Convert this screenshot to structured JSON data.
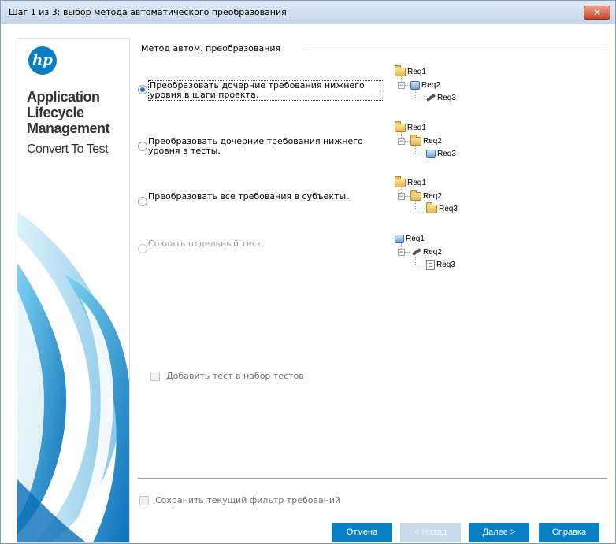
{
  "window": {
    "title": "Шаг 1 из 3: выбор метода автоматического преобразования",
    "close_label": "✕"
  },
  "branding": {
    "logo_text": "hp",
    "product_line1": "Application",
    "product_line2": "Lifecycle",
    "product_line3": "Management",
    "subtitle": "Convert To Test"
  },
  "method_group": {
    "title": "Метод автом. преобразования",
    "options": [
      {
        "label": "Преобразовать дочерние требования нижнего уровня в шаги проекта.",
        "checked": true,
        "enabled": true,
        "tree": [
          "Req1",
          "Req2",
          "Req3"
        ]
      },
      {
        "label": "Преобразовать дочерние требования нижнего уровня в тесты.",
        "checked": false,
        "enabled": true,
        "tree": [
          "Req1",
          "Req2",
          "Req3"
        ]
      },
      {
        "label": "Преобразовать все требования в субъекты.",
        "checked": false,
        "enabled": true,
        "tree": [
          "Req1",
          "Req2",
          "Req3"
        ]
      },
      {
        "label": "Создать отдельный тест.",
        "checked": false,
        "enabled": false,
        "tree": [
          "Req1",
          "Req2",
          "Req3"
        ]
      }
    ]
  },
  "add_to_test_set": {
    "label": "Добавить тест в набор тестов",
    "checked": false,
    "enabled": false
  },
  "save_filter": {
    "label": "Сохранить текущий фильтр требований",
    "checked": false,
    "enabled": false
  },
  "buttons": {
    "cancel": "Отмена",
    "back": "< Назад",
    "next": "Далее >",
    "help": "Справка"
  },
  "colors": {
    "accent": "#0b7fc3",
    "titlebar": "#c7d7ec",
    "close": "#c7432b"
  }
}
